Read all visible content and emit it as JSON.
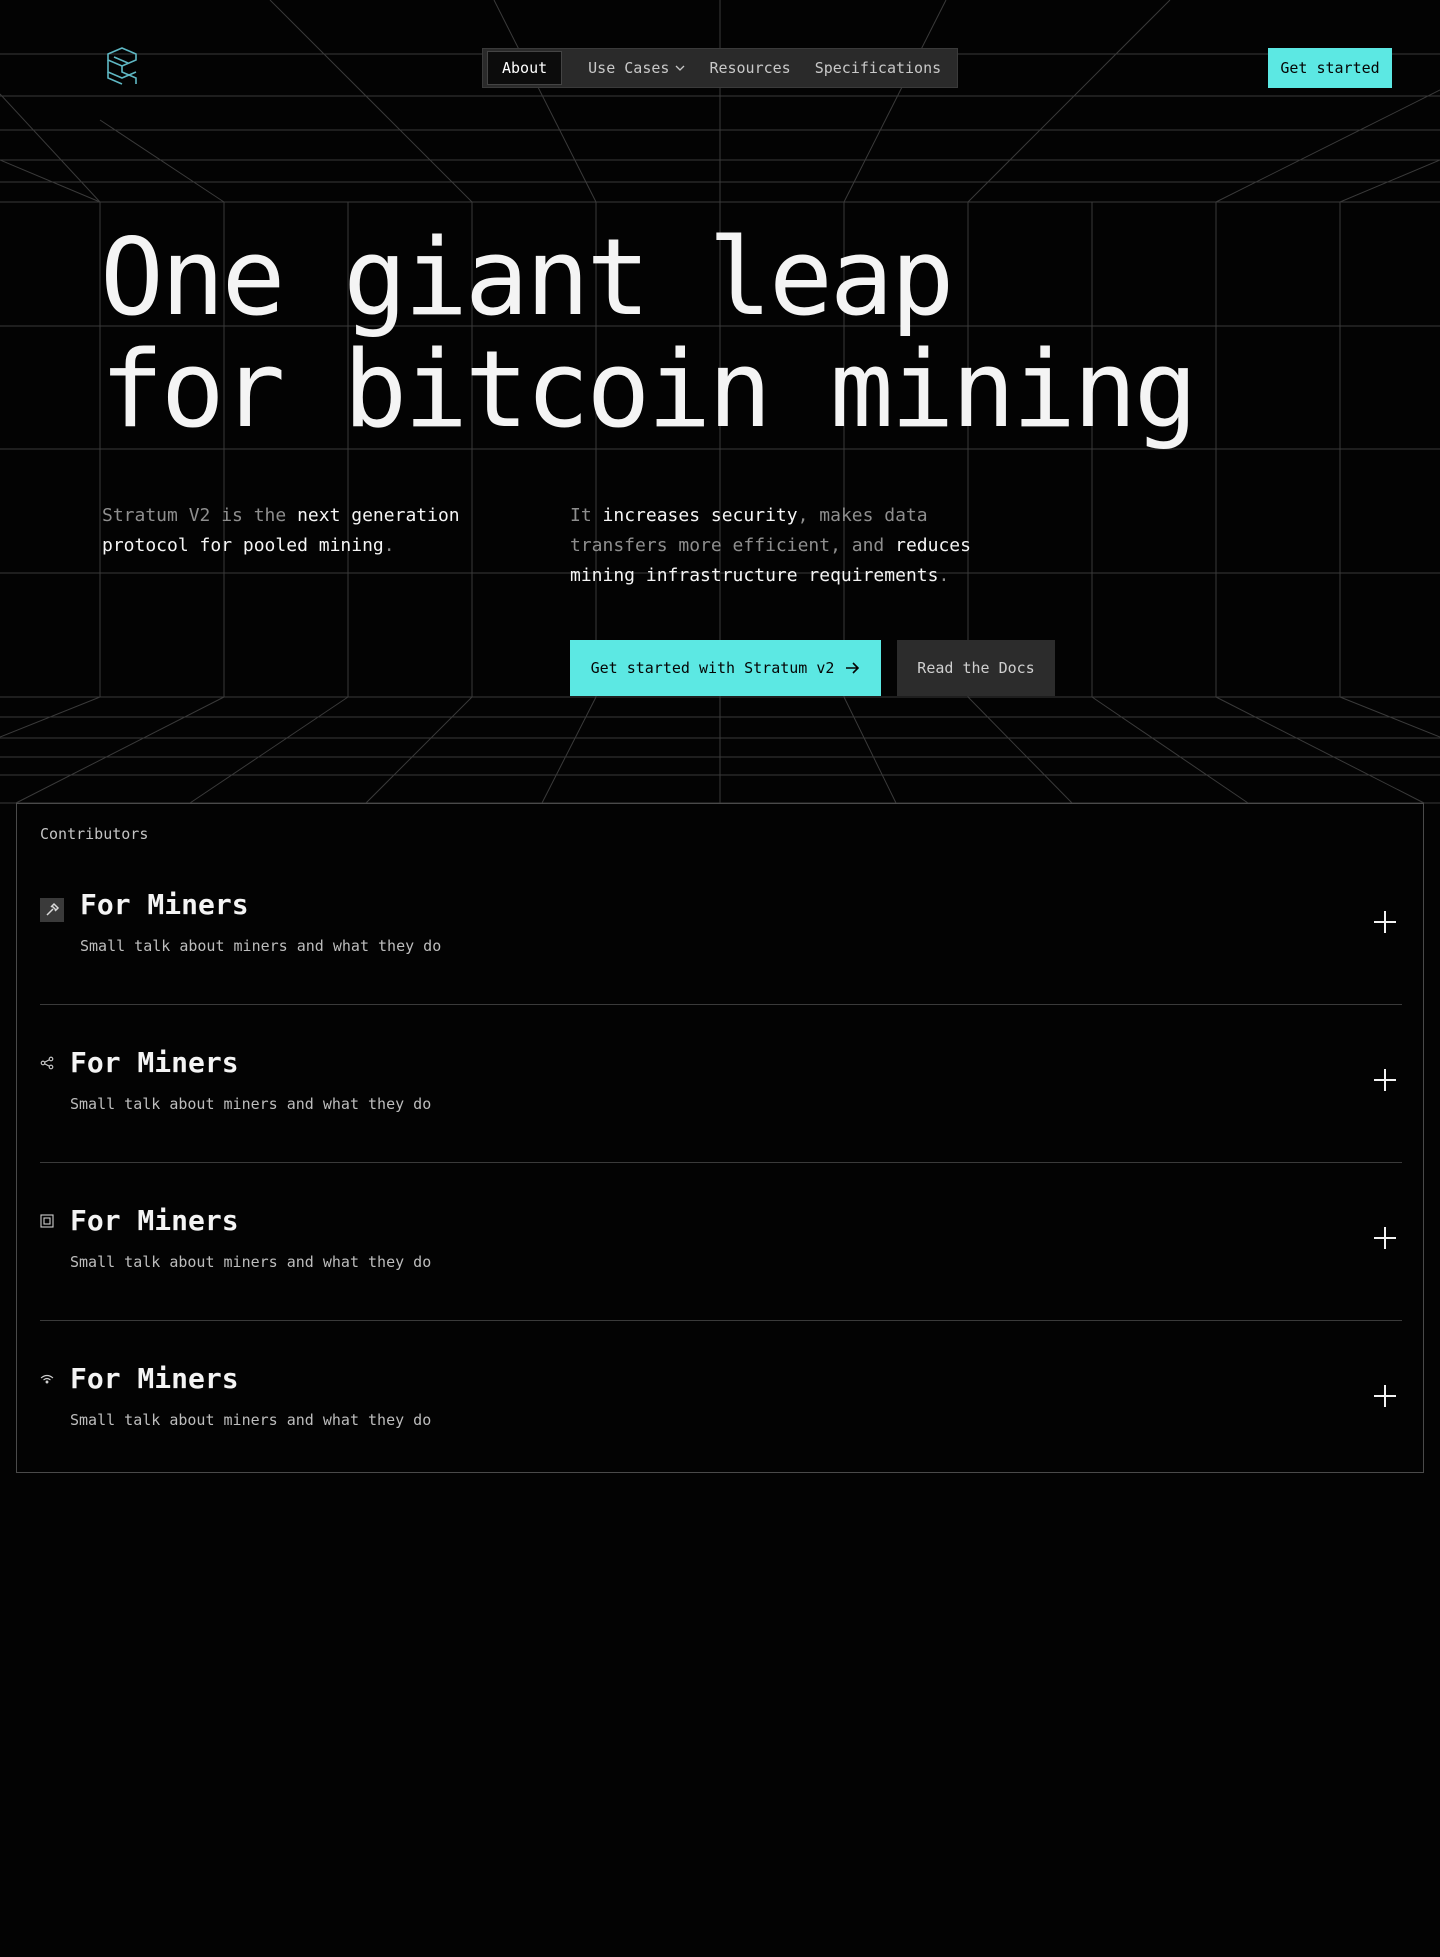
{
  "nav": {
    "items": [
      {
        "label": "About"
      },
      {
        "label": "Use Cases"
      },
      {
        "label": "Resources"
      },
      {
        "label": "Specifications"
      }
    ],
    "cta": "Get started"
  },
  "hero": {
    "title_line1": "One giant leap",
    "title_line2": "for bitcoin mining",
    "left_text": {
      "a": "Stratum V2 is the ",
      "b": "next generation protocol for pooled mining",
      "c": "."
    },
    "right_text": {
      "a": "It ",
      "b": "increases security",
      "c": ", makes data transfers more efficient, and ",
      "d": "reduces mining infrastructure requirements",
      "e": "."
    },
    "primary_button": "Get started with Stratum v2",
    "secondary_button": "Read the Docs"
  },
  "contributors": {
    "label": "Contributors",
    "items": [
      {
        "title": "For Miners",
        "description": "Small talk about miners and what they do",
        "icon": "hammer-icon"
      },
      {
        "title": "For Miners",
        "description": "Small talk about miners and what they do",
        "icon": "share-icon"
      },
      {
        "title": "For Miners",
        "description": "Small talk about miners and what they do",
        "icon": "chip-icon"
      },
      {
        "title": "For Miners",
        "description": "Small talk about miners and what they do",
        "icon": "wifi-icon"
      }
    ]
  },
  "colors": {
    "accent": "#5ce8e3",
    "background": "#030303",
    "grid_line": "#3a3a3a"
  }
}
